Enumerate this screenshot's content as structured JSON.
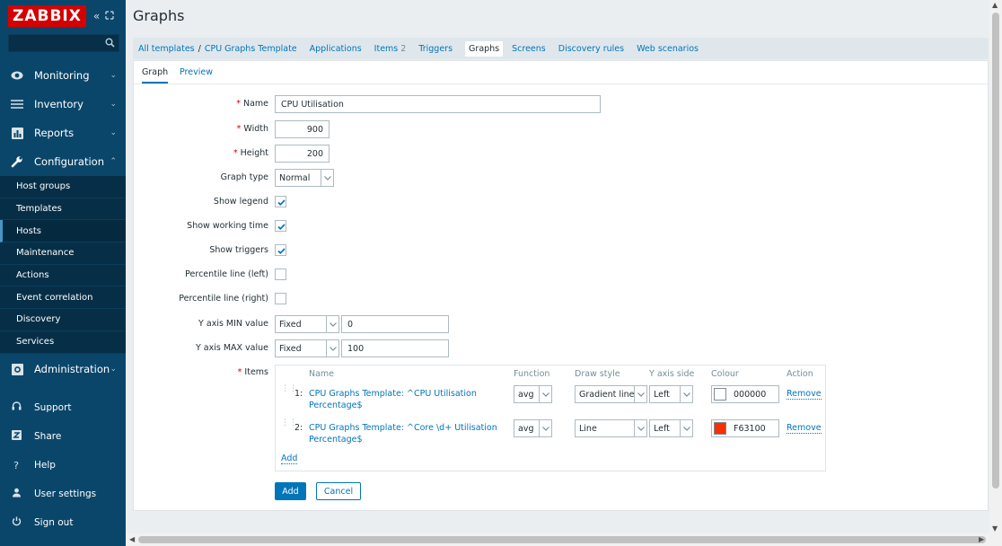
{
  "app": {
    "logo": "ZABBIX",
    "page_title": "Graphs"
  },
  "colors": {
    "sidebar_bg": "#0a466a",
    "accent": "#0275b8",
    "logo_red": "#d40000",
    "required": "#d40000"
  },
  "sidebar": {
    "menu": [
      {
        "label": "Monitoring",
        "icon": "eye-icon"
      },
      {
        "label": "Inventory",
        "icon": "list-icon"
      },
      {
        "label": "Reports",
        "icon": "bar-chart-icon"
      },
      {
        "label": "Configuration",
        "icon": "wrench-icon"
      }
    ],
    "submenu": [
      "Host groups",
      "Templates",
      "Hosts",
      "Maintenance",
      "Actions",
      "Event correlation",
      "Discovery",
      "Services"
    ],
    "submenu_active": "Hosts",
    "admin": {
      "label": "Administration",
      "icon": "gear-icon"
    },
    "bottom": [
      {
        "label": "Support",
        "icon": "headset-icon"
      },
      {
        "label": "Share",
        "icon": "share-icon"
      },
      {
        "label": "Help",
        "icon": "question-icon"
      },
      {
        "label": "User settings",
        "icon": "user-icon"
      },
      {
        "label": "Sign out",
        "icon": "power-icon"
      }
    ]
  },
  "nav": {
    "crumb_root": "All templates",
    "crumb_sep": "/",
    "crumb_template": "CPU Graphs Template",
    "tabs": [
      {
        "label": "Applications"
      },
      {
        "label": "Items",
        "count": "2"
      },
      {
        "label": "Triggers"
      },
      {
        "label": "Graphs",
        "active": true
      },
      {
        "label": "Screens"
      },
      {
        "label": "Discovery rules"
      },
      {
        "label": "Web scenarios"
      }
    ]
  },
  "form_tabs": {
    "graph": "Graph",
    "preview": "Preview"
  },
  "form": {
    "name_label": "Name",
    "name_value": "CPU Utilisation",
    "width_label": "Width",
    "width_value": "900",
    "height_label": "Height",
    "height_value": "200",
    "graph_type_label": "Graph type",
    "graph_type_value": "Normal",
    "show_legend_label": "Show legend",
    "show_legend": true,
    "show_working_time_label": "Show working time",
    "show_working_time": true,
    "show_triggers_label": "Show triggers",
    "show_triggers": true,
    "percentile_left_label": "Percentile line (left)",
    "percentile_left": false,
    "percentile_right_label": "Percentile line (right)",
    "percentile_right": false,
    "ymin_label": "Y axis MIN value",
    "ymin_type": "Fixed",
    "ymin_value": "0",
    "ymax_label": "Y axis MAX value",
    "ymax_type": "Fixed",
    "ymax_value": "100",
    "items_label": "Items",
    "required_mark": "*"
  },
  "items_table": {
    "headers": {
      "name": "Name",
      "function": "Function",
      "draw_style": "Draw style",
      "y_axis_side": "Y axis side",
      "colour": "Colour",
      "action": "Action"
    },
    "rows": [
      {
        "index": "1:",
        "name_line1": "CPU Graphs Template: ^CPU Utilisation",
        "name_line2": "Percentage$",
        "function": "avg",
        "draw_style": "Gradient line",
        "y_axis_side": "Left",
        "colour": "000000",
        "swatch": "#ffffff",
        "action": "Remove"
      },
      {
        "index": "2:",
        "name_line1": "CPU Graphs Template: ^Core \\d+ Utilisation",
        "name_line2": "Percentage$",
        "function": "avg",
        "draw_style": "Line",
        "y_axis_side": "Left",
        "colour": "F63100",
        "swatch": "#f63100",
        "action": "Remove"
      }
    ],
    "add_label": "Add"
  },
  "buttons": {
    "add": "Add",
    "cancel": "Cancel"
  }
}
